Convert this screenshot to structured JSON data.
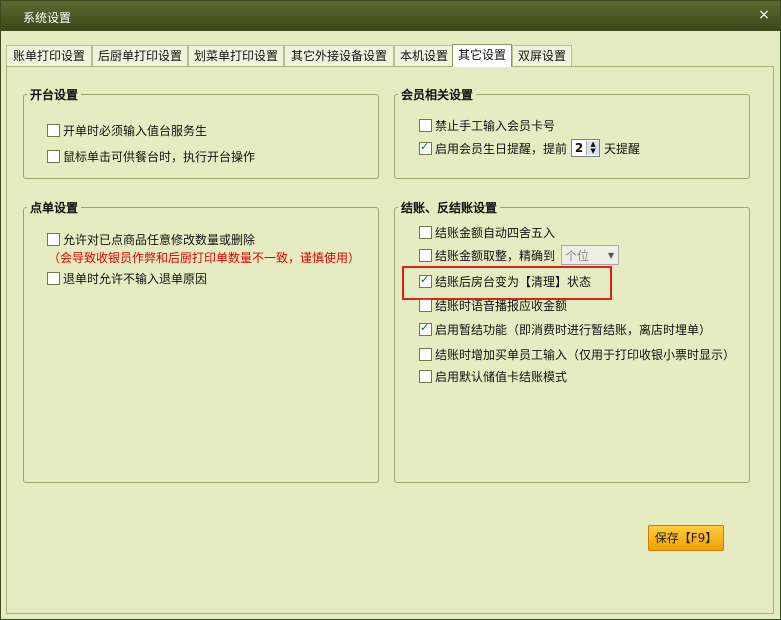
{
  "window": {
    "title": "系统设置",
    "close_label": "×"
  },
  "tabs": [
    {
      "label": "账单打印设置"
    },
    {
      "label": "后厨单打印设置"
    },
    {
      "label": "划菜单打印设置"
    },
    {
      "label": "其它外接设备设置"
    },
    {
      "label": "本机设置"
    },
    {
      "label": "其它设置",
      "active": true
    },
    {
      "label": "双屏设置"
    }
  ],
  "open_table": {
    "title": "开台设置",
    "options": [
      {
        "label": "开单时必须输入值台服务生",
        "checked": false
      },
      {
        "label": "鼠标单击可供餐台时，执行开台操作",
        "checked": false
      }
    ]
  },
  "member": {
    "title": "会员相关设置",
    "opt_manual": {
      "label": "禁止手工输入会员卡号",
      "checked": false
    },
    "opt_birthday": {
      "label": "启用会员生日提醒，提前",
      "checked": true,
      "days": "2",
      "suffix": "天提醒"
    }
  },
  "order": {
    "title": "点单设置",
    "opt_modify": {
      "label": "允许对已点商品任意修改数量或删除",
      "checked": false
    },
    "warning": "（会导致收银员作弊和后厨打印单数量不一致，谨慎使用）",
    "opt_return": {
      "label": "退单时允许不输入退单原因",
      "checked": false
    }
  },
  "checkout": {
    "title": "结账、反结账设置",
    "opt_round": {
      "label": "结账金额自动四舍五入",
      "checked": false
    },
    "opt_precision": {
      "label": "结账金额取整，精确到",
      "checked": false,
      "select_value": "个位"
    },
    "opt_clean": {
      "label": "结账后房台变为【清理】状态",
      "checked": true
    },
    "opt_voice": {
      "label": "结账时语音播报应收金额",
      "checked": false
    },
    "opt_suspend": {
      "label": "启用暂结功能（即消费时进行暂结账，离店时埋单）",
      "checked": true
    },
    "opt_staff": {
      "label": "结账时增加买单员工输入（仅用于打印收银小票时显示）",
      "checked": false
    },
    "opt_card": {
      "label": "启用默认储值卡结账模式",
      "checked": false
    }
  },
  "save_button": {
    "label": "保存【F9】"
  },
  "colors": {
    "highlight": "#e0201a",
    "save": "#f3a000",
    "warning": "#e00000"
  }
}
